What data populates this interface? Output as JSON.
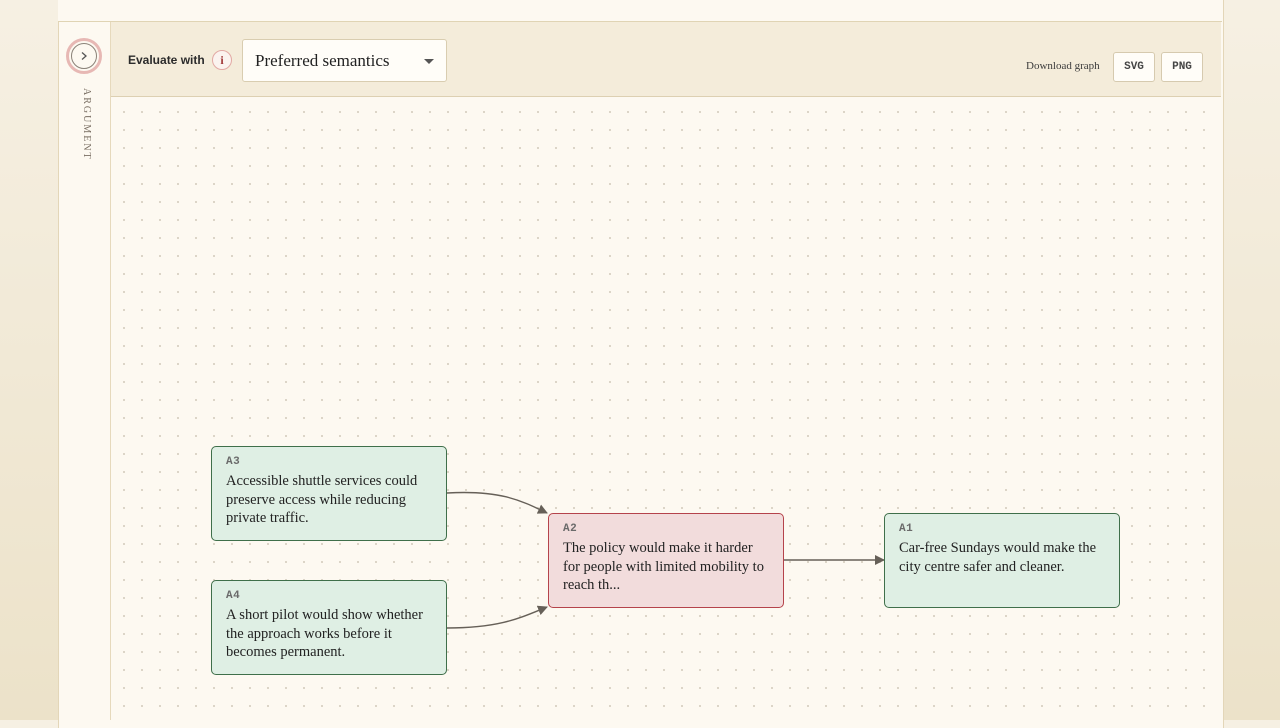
{
  "sidebar": {
    "expand_icon": "chevron-right-icon",
    "label": "ARGUMENT"
  },
  "toolbar": {
    "evaluate_label": "Evaluate with",
    "info_icon": "i",
    "semantics_select": {
      "value": "Preferred semantics"
    },
    "download_label": "Download graph",
    "svg_label": "SVG",
    "png_label": "PNG"
  },
  "graph": {
    "nodes": [
      {
        "id": "A3",
        "text": "Accessible shuttle services could preserve access while reducing private traffic.",
        "status": "accepted"
      },
      {
        "id": "A4",
        "text": "A short pilot would show whether the approach works before it becomes permanent.",
        "status": "accepted"
      },
      {
        "id": "A2",
        "text": "The policy would make it harder for people with limited mobility to reach th...",
        "status": "rejected"
      },
      {
        "id": "A1",
        "text": "Car-free Sundays would make the city centre safer and cleaner.",
        "status": "accepted"
      }
    ],
    "edges": [
      {
        "from": "A3",
        "to": "A2"
      },
      {
        "from": "A4",
        "to": "A2"
      },
      {
        "from": "A2",
        "to": "A1"
      }
    ],
    "colors": {
      "accepted_fill": "#dfefe4",
      "accepted_border": "#3f6f4a",
      "rejected_fill": "#f2dcdc",
      "rejected_border": "#b5434b",
      "edge": "#666058"
    }
  }
}
